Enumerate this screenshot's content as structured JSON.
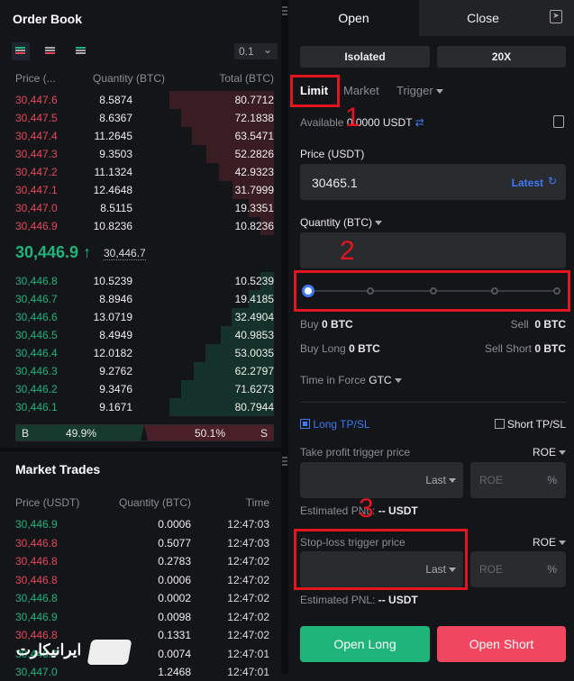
{
  "order_book": {
    "title": "Order Book",
    "precision": "0.1",
    "headers": [
      "Price (...",
      "Quantity (BTC)",
      "Total (BTC)"
    ],
    "asks": [
      [
        "30,447.6",
        "8.5874",
        "80.7712"
      ],
      [
        "30,447.5",
        "8.6367",
        "72.1838"
      ],
      [
        "30,447.4",
        "11.2645",
        "63.5471"
      ],
      [
        "30,447.3",
        "9.3503",
        "52.2826"
      ],
      [
        "30,447.2",
        "11.1324",
        "42.9323"
      ],
      [
        "30,447.1",
        "12.4648",
        "31.7999"
      ],
      [
        "30,447.0",
        "8.5115",
        "19.3351"
      ],
      [
        "30,446.9",
        "10.8236",
        "10.8236"
      ]
    ],
    "last_price": "30,446.9",
    "mark_price": "30,446.7",
    "bids": [
      [
        "30,446.8",
        "10.5239",
        "10.5239"
      ],
      [
        "30,446.7",
        "8.8946",
        "19.4185"
      ],
      [
        "30,446.6",
        "13.0719",
        "32.4904"
      ],
      [
        "30,446.5",
        "8.4949",
        "40.9853"
      ],
      [
        "30,446.4",
        "12.0182",
        "53.0035"
      ],
      [
        "30,446.3",
        "9.2762",
        "62.2797"
      ],
      [
        "30,446.2",
        "9.3476",
        "71.6273"
      ],
      [
        "30,446.1",
        "9.1671",
        "80.7944"
      ]
    ],
    "buy_label": "B",
    "buy_pct": "49.9%",
    "sell_label": "S",
    "sell_pct": "50.1%"
  },
  "market_trades": {
    "title": "Market Trades",
    "headers": [
      "Price (USDT)",
      "Quantity (BTC)",
      "Time"
    ],
    "rows": [
      [
        "30,446.9",
        "0.0006",
        "12:47:03",
        "buy"
      ],
      [
        "30,446.8",
        "0.5077",
        "12:47:03",
        "sell"
      ],
      [
        "30,446.8",
        "0.2783",
        "12:47:02",
        "sell"
      ],
      [
        "30,446.8",
        "0.0006",
        "12:47:02",
        "sell"
      ],
      [
        "30,446.8",
        "0.0002",
        "12:47:02",
        "buy"
      ],
      [
        "30,446.9",
        "0.0098",
        "12:47:02",
        "buy"
      ],
      [
        "30,446.8",
        "0.1331",
        "12:47:02",
        "sell"
      ],
      [
        "30,446.9",
        "0.0074",
        "12:47:01",
        "buy"
      ],
      [
        "30,447.0",
        "1.2468",
        "12:47:01",
        "buy"
      ]
    ]
  },
  "watermark": "ایرانیکارت",
  "trade": {
    "tabs": [
      "Open",
      "Close"
    ],
    "margin_mode": "Isolated",
    "leverage": "20X",
    "order_types": [
      "Limit",
      "Market",
      "Trigger"
    ],
    "available_label": "Available",
    "available_value": "0.0000 USDT",
    "price_label": "Price (USDT)",
    "price_value": "30465.1",
    "latest": "Latest",
    "quantity_label": "Quantity (BTC)",
    "slider_percent": 0,
    "buy_label": "Buy",
    "buy_value": "0 BTC",
    "sell_label": "Sell",
    "sell_value": "0 BTC",
    "buy_long_label": "Buy Long",
    "buy_long_value": "0 BTC",
    "sell_short_label": "Sell Short",
    "sell_short_value": "0 BTC",
    "tif_label": "Time in Force",
    "tif_value": "GTC",
    "long_tpsl": "Long TP/SL",
    "short_tpsl": "Short TP/SL",
    "tp_label": "Take profit trigger price",
    "sl_label": "Stop-loss trigger price",
    "roe": "ROE",
    "last": "Last",
    "roe_placeholder": "ROE",
    "percent": "%",
    "pnl_label": "Estimated PNL:",
    "pnl_value": "-- USDT",
    "open_long": "Open Long",
    "open_short": "Open Short"
  },
  "annotations": [
    "1",
    "2",
    "3"
  ],
  "colors": {
    "green": "#1fb57a",
    "red": "#e8475a",
    "accent": "#3d7bf5",
    "annotation": "#e3161f"
  }
}
